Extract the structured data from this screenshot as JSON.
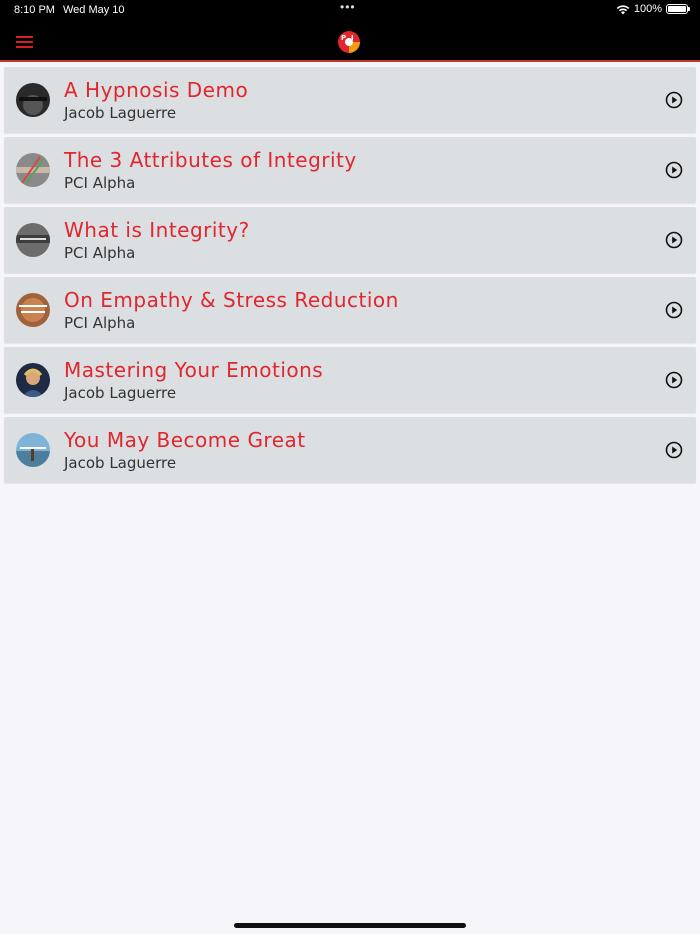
{
  "status_bar": {
    "time": "8:10 PM",
    "date": "Wed May 10",
    "battery": "100%",
    "dots": "•••",
    "wifi_icon": "wifi-icon",
    "battery_icon": "battery-icon"
  },
  "nav": {
    "menu_icon": "hamburger-menu-icon",
    "logo_icon": "pci-logo-icon",
    "accent_color": "#d91e26"
  },
  "items": [
    {
      "title": "A Hypnosis Demo",
      "author": "Jacob Laguerre",
      "thumb_text": "A HYPNOSIS DEMO"
    },
    {
      "title": "The 3 Attributes of Integrity",
      "author": "PCI Alpha",
      "thumb_text": ""
    },
    {
      "title": "What is Integrity?",
      "author": "PCI Alpha",
      "thumb_text": "WHAT IS INTEGRITY"
    },
    {
      "title": "On Empathy & Stress Reduction",
      "author": "PCI Alpha",
      "thumb_text": "ON EMPATHY & STRESS REDUCTION"
    },
    {
      "title": "Mastering Your Emotions",
      "author": "Jacob Laguerre",
      "thumb_text": ""
    },
    {
      "title": "You May Become Great",
      "author": "Jacob Laguerre",
      "thumb_text": "YOU MAY BECOME GREAT"
    }
  ]
}
